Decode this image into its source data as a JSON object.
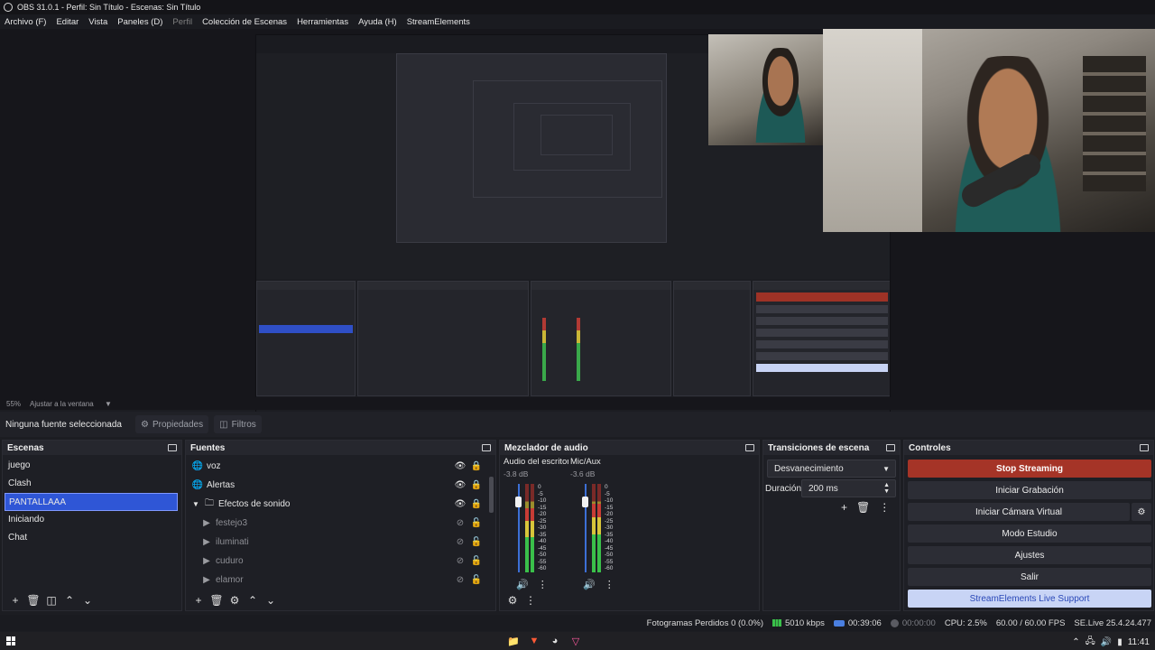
{
  "window": {
    "title": "OBS 31.0.1 - Perfil: Sin Título - Escenas: Sin Título"
  },
  "menu": [
    "Archivo (F)",
    "Editar",
    "Vista",
    "Paneles (D)",
    "Perfil",
    "Colección de Escenas",
    "Herramientas",
    "Ayuda (H)",
    "StreamElements"
  ],
  "preview": {
    "zoom": "55%",
    "fit_label": "Ajustar a la ventana"
  },
  "properties_bar": {
    "no_source": "Ninguna fuente seleccionada",
    "properties": "Propiedades",
    "filters": "Filtros"
  },
  "scenes": {
    "title": "Escenas",
    "items": [
      "juego",
      "Clash",
      "PANTALLAAA",
      "Iniciando",
      "Chat"
    ],
    "selected": "PANTALLAAA"
  },
  "sources": {
    "title": "Fuentes",
    "items": [
      {
        "name": "voz",
        "icon": "globe-icon",
        "visible": true
      },
      {
        "name": "Alertas",
        "icon": "globe-icon",
        "visible": true
      },
      {
        "name": "Efectos de sonido",
        "icon": "folder-icon",
        "visible": true,
        "group": true
      },
      {
        "name": "festejo3",
        "icon": "play-icon",
        "visible": false
      },
      {
        "name": "iluminati",
        "icon": "play-icon",
        "visible": false
      },
      {
        "name": "cuduro",
        "icon": "play-icon",
        "visible": false
      },
      {
        "name": "elamor",
        "icon": "play-icon",
        "visible": false
      }
    ]
  },
  "mixer": {
    "title": "Mezclador de audio",
    "channels": [
      {
        "name": "Audio del escritorio",
        "db": "-3.8 dB",
        "level": 0.72
      },
      {
        "name": "Mic/Aux",
        "db": "-3.6 dB",
        "level": 0.78
      }
    ],
    "scale": [
      "0",
      "-5",
      "-10",
      "-15",
      "-20",
      "-25",
      "-30",
      "-35",
      "-40",
      "-45",
      "-50",
      "-55",
      "-60"
    ]
  },
  "transitions": {
    "title": "Transiciones de escena",
    "selected": "Desvanecimiento",
    "duration_label": "Duración",
    "duration_value": "200 ms"
  },
  "controls": {
    "title": "Controles",
    "stop_streaming": "Stop Streaming",
    "start_recording": "Iniciar Grabación",
    "virtual_camera": "Iniciar Cámara Virtual",
    "studio_mode": "Modo Estudio",
    "settings": "Ajustes",
    "exit": "Salir",
    "support": "StreamElements Live Support"
  },
  "status": {
    "dropped": "Fotogramas Perdidos 0 (0.0%)",
    "bitrate": "5010 kbps",
    "stream_time": "00:39:06",
    "rec_time": "00:00:00",
    "cpu": "CPU: 2.5%",
    "fps": "60.00 / 60.00 FPS",
    "se_version": "SE.Live 25.4.24.477"
  },
  "taskbar": {
    "clock": "11:41"
  },
  "colors": {
    "accent": "#2f56d6",
    "stop": "#a53427",
    "support_bg": "#c8d4f5"
  }
}
